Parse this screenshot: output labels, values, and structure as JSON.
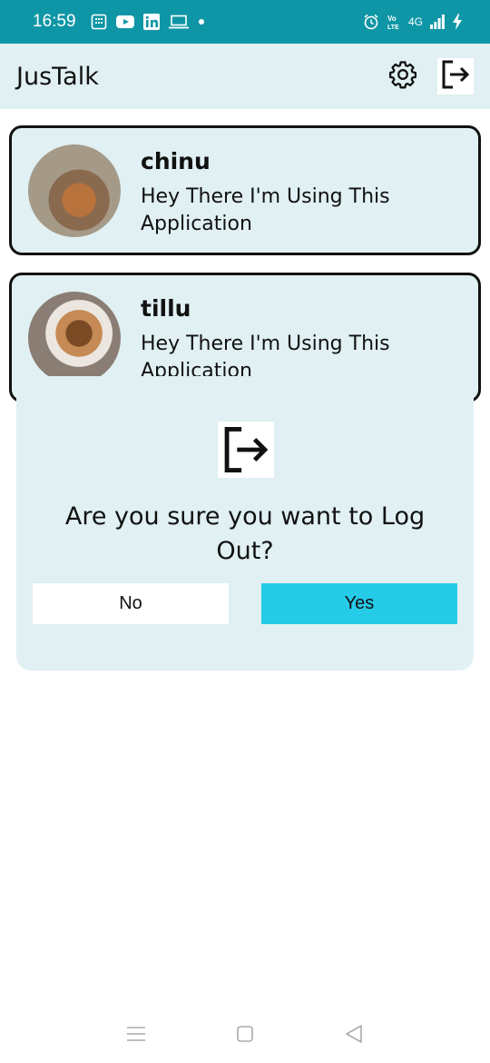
{
  "status_bar": {
    "time": "16:59",
    "network_label": "4G",
    "background_color": "#0f96a6",
    "left_icons": [
      "calendar-icon",
      "youtube-icon",
      "linkedin-icon",
      "laptop-icon",
      "dot-icon"
    ],
    "right_icons": [
      "alarm-icon",
      "volte-icon",
      "signal-icon",
      "charging-icon"
    ]
  },
  "app_bar": {
    "title": "JusTalk",
    "background_color": "#e0f0f3",
    "actions": [
      "settings-gear-icon",
      "logout-icon"
    ]
  },
  "chats": [
    {
      "name": "chinu",
      "status": "Hey There I'm Using This Application",
      "avatar": "dog-photo"
    },
    {
      "name": "tillu",
      "status": "Hey There I'm Using This Application",
      "avatar": "dog-photo"
    }
  ],
  "dialog": {
    "icon": "logout-icon",
    "message": "Are you sure you want to Log Out?",
    "no_label": "No",
    "yes_label": "Yes",
    "yes_color": "#26cbe8"
  },
  "nav_bar": {
    "icons": [
      "menu-icon",
      "home-icon",
      "back-icon"
    ]
  }
}
